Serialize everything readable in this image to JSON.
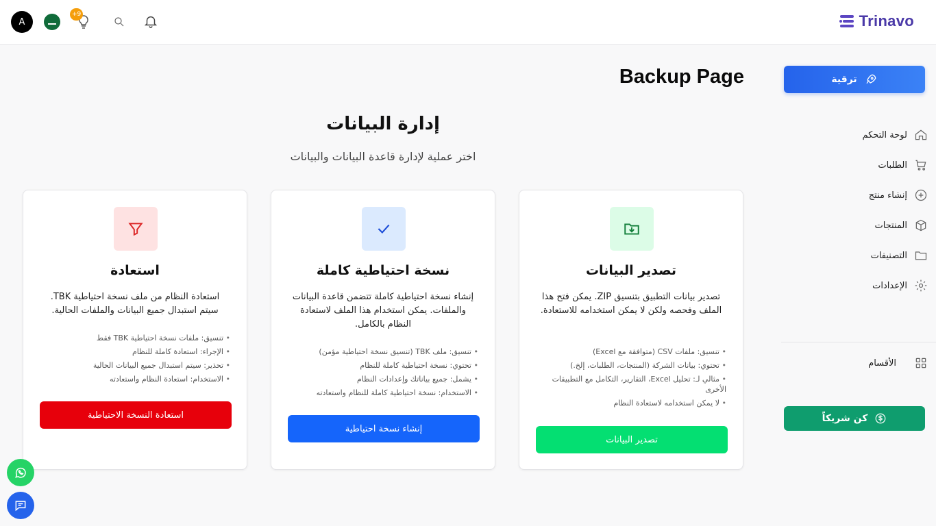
{
  "header": {
    "logo_text": "Trinavo",
    "avatar_letter": "A",
    "notification_badge": "+9",
    "icons": [
      "flag-icon",
      "lightbulb-icon",
      "search-icon",
      "bell-icon"
    ]
  },
  "sidebar": {
    "upgrade_label": "ترقية",
    "items": [
      {
        "label": "لوحة التحكم",
        "icon": "home-icon"
      },
      {
        "label": "الطلبات",
        "icon": "cart-icon"
      },
      {
        "label": "إنشاء منتج",
        "icon": "plus-circle-icon"
      },
      {
        "label": "المنتجات",
        "icon": "box-icon"
      },
      {
        "label": "التصنيفات",
        "icon": "folder-icon"
      },
      {
        "label": "الإعدادات",
        "icon": "gear-icon"
      }
    ],
    "sections_label": "الأقسام",
    "partner_label": "كن شريكاً"
  },
  "page": {
    "title": "Backup Page",
    "heading": "إدارة البيانات",
    "subheading": "اختر عملية لإدارة قاعدة البيانات والبيانات"
  },
  "cards": [
    {
      "title": "تصدير البيانات",
      "description": "تصدير بيانات التطبيق بتنسيق ZIP. يمكن فتح هذا الملف وفحصه ولكن لا يمكن استخدامه للاستعادة.",
      "bullets": [
        "تنسيق: ملفات CSV (متوافقة مع Excel)",
        "تحتوي: بيانات الشركة (المنتجات، الطلبات، إلخ.)",
        "مثالي لـ: تحليل Excel، التقارير، التكامل مع التطبيقات الأخرى",
        "لا يمكن استخدامه لاستعادة النظام"
      ],
      "button": "تصدير البيانات",
      "accent": "#04df72",
      "icon_bg": "#dcfce7",
      "icon_color": "#15803d"
    },
    {
      "title": "نسخة احتياطية كاملة",
      "description": "إنشاء نسخة احتياطية كاملة تتضمن قاعدة البيانات والملفات. يمكن استخدام هذا الملف لاستعادة النظام بالكامل.",
      "bullets": [
        "تنسيق: ملف TBK (تنسيق نسخة احتياطية مؤمن)",
        "تحتوي: نسخة احتياطية كاملة للنظام",
        "يشمل: جميع بياناتك وإعدادات النظام",
        "الاستخدام: نسخة احتياطية كاملة للنظام واستعادته"
      ],
      "button": "إنشاء نسخة احتياطية",
      "accent": "#1565fb",
      "icon_bg": "#dbeafe",
      "icon_color": "#1d4ed8"
    },
    {
      "title": "استعادة",
      "description": "استعادة النظام من ملف نسخة احتياطية TBK. سيتم استبدال جميع البيانات والملفات الحالية.",
      "bullets": [
        "تنسيق: ملفات نسخة احتياطية TBK فقط",
        "الإجراء: استعادة كاملة للنظام",
        "تحذير: سيتم استبدال جميع البيانات الحالية",
        "الاستخدام: استعادة النظام واستعادته"
      ],
      "button": "استعادة النسخة الاحتياطية",
      "accent": "#e7000b",
      "icon_bg": "#fee2e2",
      "icon_color": "#dc2626"
    }
  ],
  "floating": {
    "whatsapp_color": "#25d366",
    "chat_color": "#2563eb"
  }
}
